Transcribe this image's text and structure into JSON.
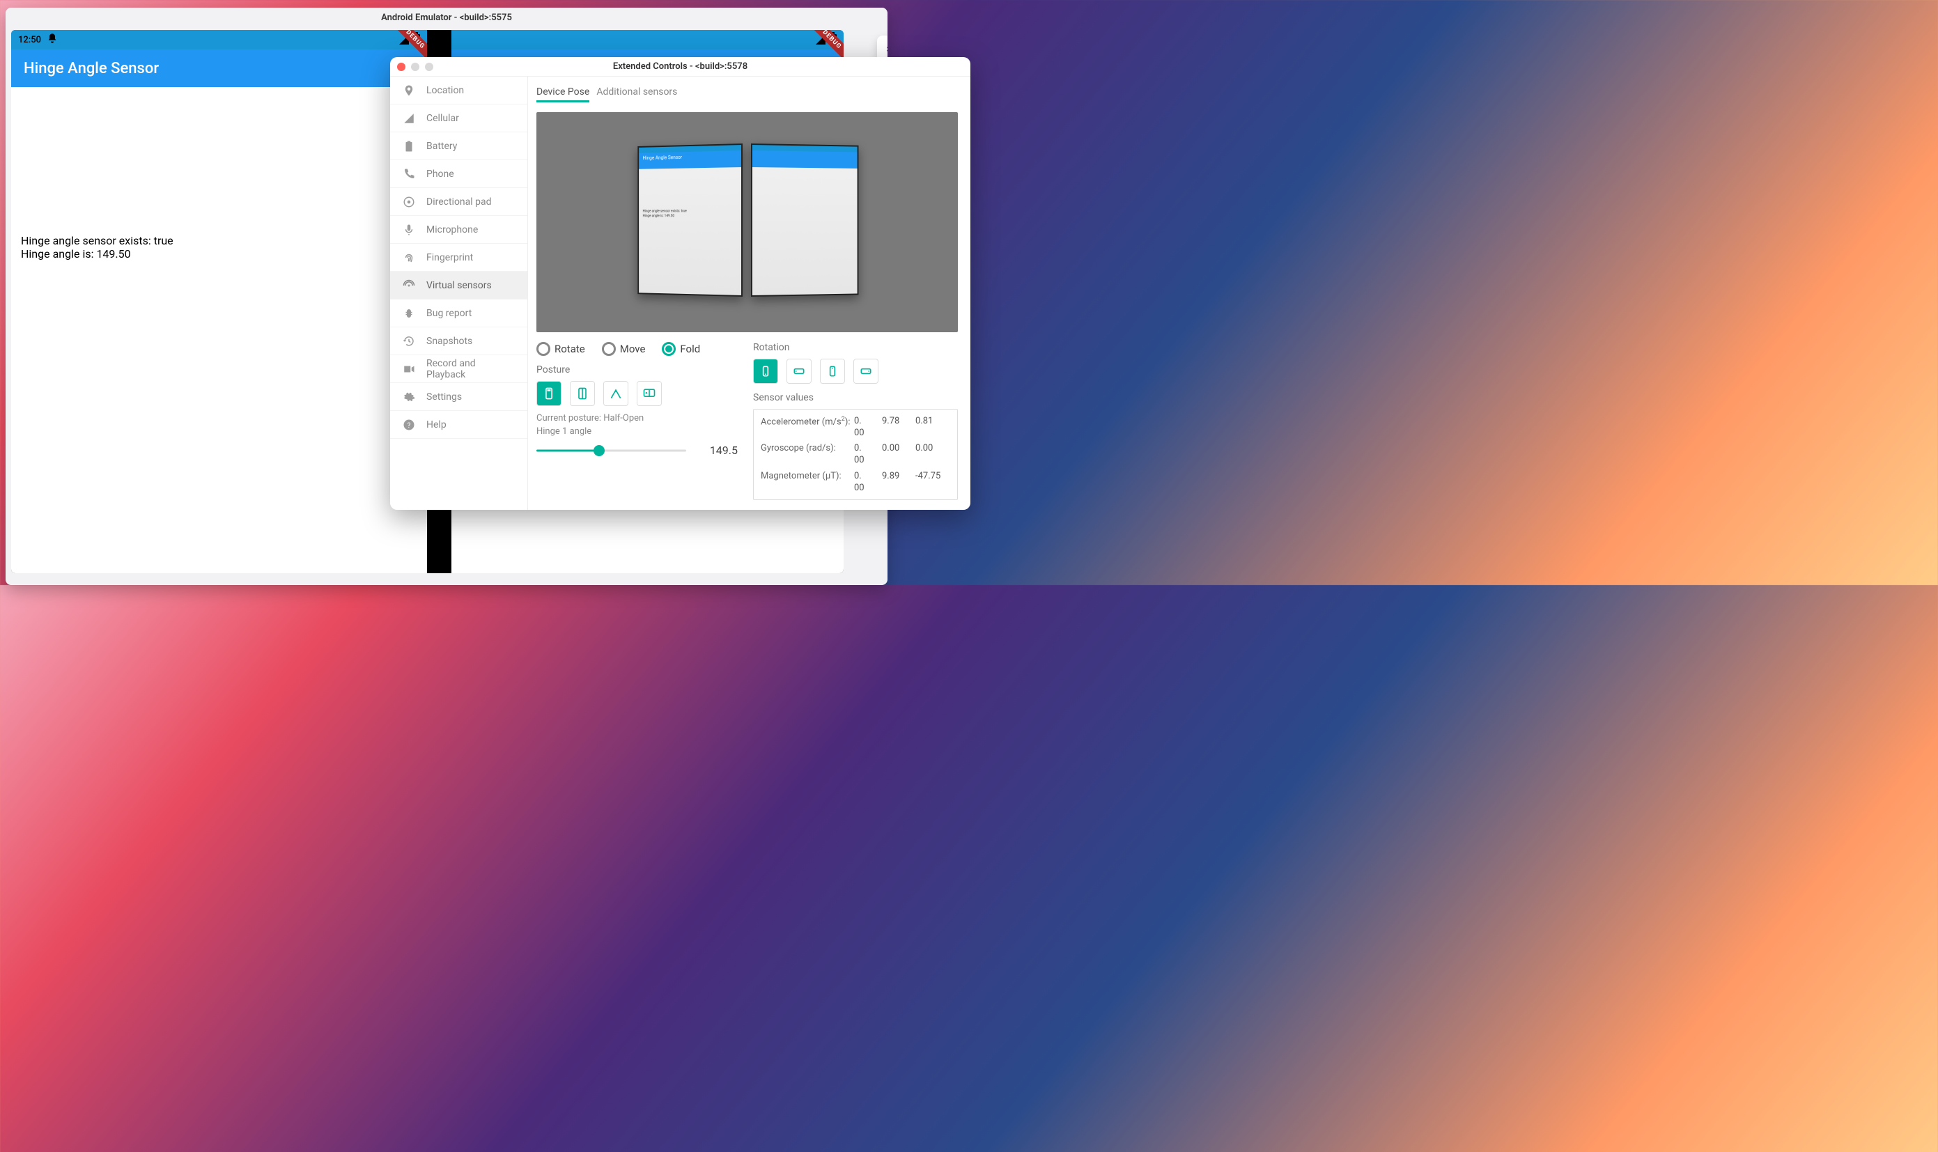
{
  "emulator": {
    "title": "Android Emulator - <build>:5575",
    "statusbar": {
      "time": "12:50",
      "debug_banner": "DEBUG"
    },
    "app_title": "Hinge Angle Sensor",
    "body_line1": "Hinge angle sensor exists: true",
    "body_line2": "Hinge angle is: 149.50"
  },
  "ext": {
    "title": "Extended Controls - <build>:5578",
    "sidebar": {
      "items": [
        {
          "id": "location",
          "label": "Location"
        },
        {
          "id": "cellular",
          "label": "Cellular"
        },
        {
          "id": "battery",
          "label": "Battery"
        },
        {
          "id": "phone",
          "label": "Phone"
        },
        {
          "id": "dpad",
          "label": "Directional pad"
        },
        {
          "id": "microphone",
          "label": "Microphone"
        },
        {
          "id": "fingerprint",
          "label": "Fingerprint"
        },
        {
          "id": "virtual-sensors",
          "label": "Virtual sensors"
        },
        {
          "id": "bug-report",
          "label": "Bug report"
        },
        {
          "id": "snapshots",
          "label": "Snapshots"
        },
        {
          "id": "record-playback",
          "label": "Record and Playback"
        },
        {
          "id": "settings",
          "label": "Settings"
        },
        {
          "id": "help",
          "label": "Help"
        }
      ],
      "selected": "virtual-sensors"
    },
    "tabs": {
      "device_pose": "Device Pose",
      "additional_sensors": "Additional sensors",
      "active": "device_pose"
    },
    "preview": {
      "mini_title": "Hinge Angle Sensor",
      "mini_text": "Hinge angle sensor exists: true\nHinge angle is: 149.50"
    },
    "mode": {
      "rotate": "Rotate",
      "move": "Move",
      "fold": "Fold",
      "selected": "fold"
    },
    "posture": {
      "label": "Posture",
      "buttons": [
        "closed",
        "half-open-book",
        "tent",
        "tabletop"
      ],
      "active": "closed",
      "current_prefix": "Current posture: ",
      "current_value": "Half-Open",
      "hinge_label": "Hinge 1 angle",
      "hinge_value": "149.5",
      "slider_percent": 42
    },
    "rotation": {
      "label": "Rotation",
      "active": "portrait",
      "buttons": [
        "portrait",
        "landscape-left",
        "portrait-rev",
        "landscape-right"
      ]
    },
    "sensors": {
      "title": "Sensor values",
      "rows": [
        {
          "label": "Accelerometer (m/s²):",
          "v1": "0.\n00",
          "v2": "9.78",
          "v3": "0.81"
        },
        {
          "label": "Gyroscope (rad/s):",
          "v1": "0.\n00",
          "v2": "0.00",
          "v3": "0.00"
        },
        {
          "label": "Magnetometer (μT):",
          "v1": "0.\n00",
          "v2": "9.89",
          "v3": "-47.75"
        }
      ]
    }
  },
  "parent_window": {
    "close": "×",
    "min": "–"
  }
}
